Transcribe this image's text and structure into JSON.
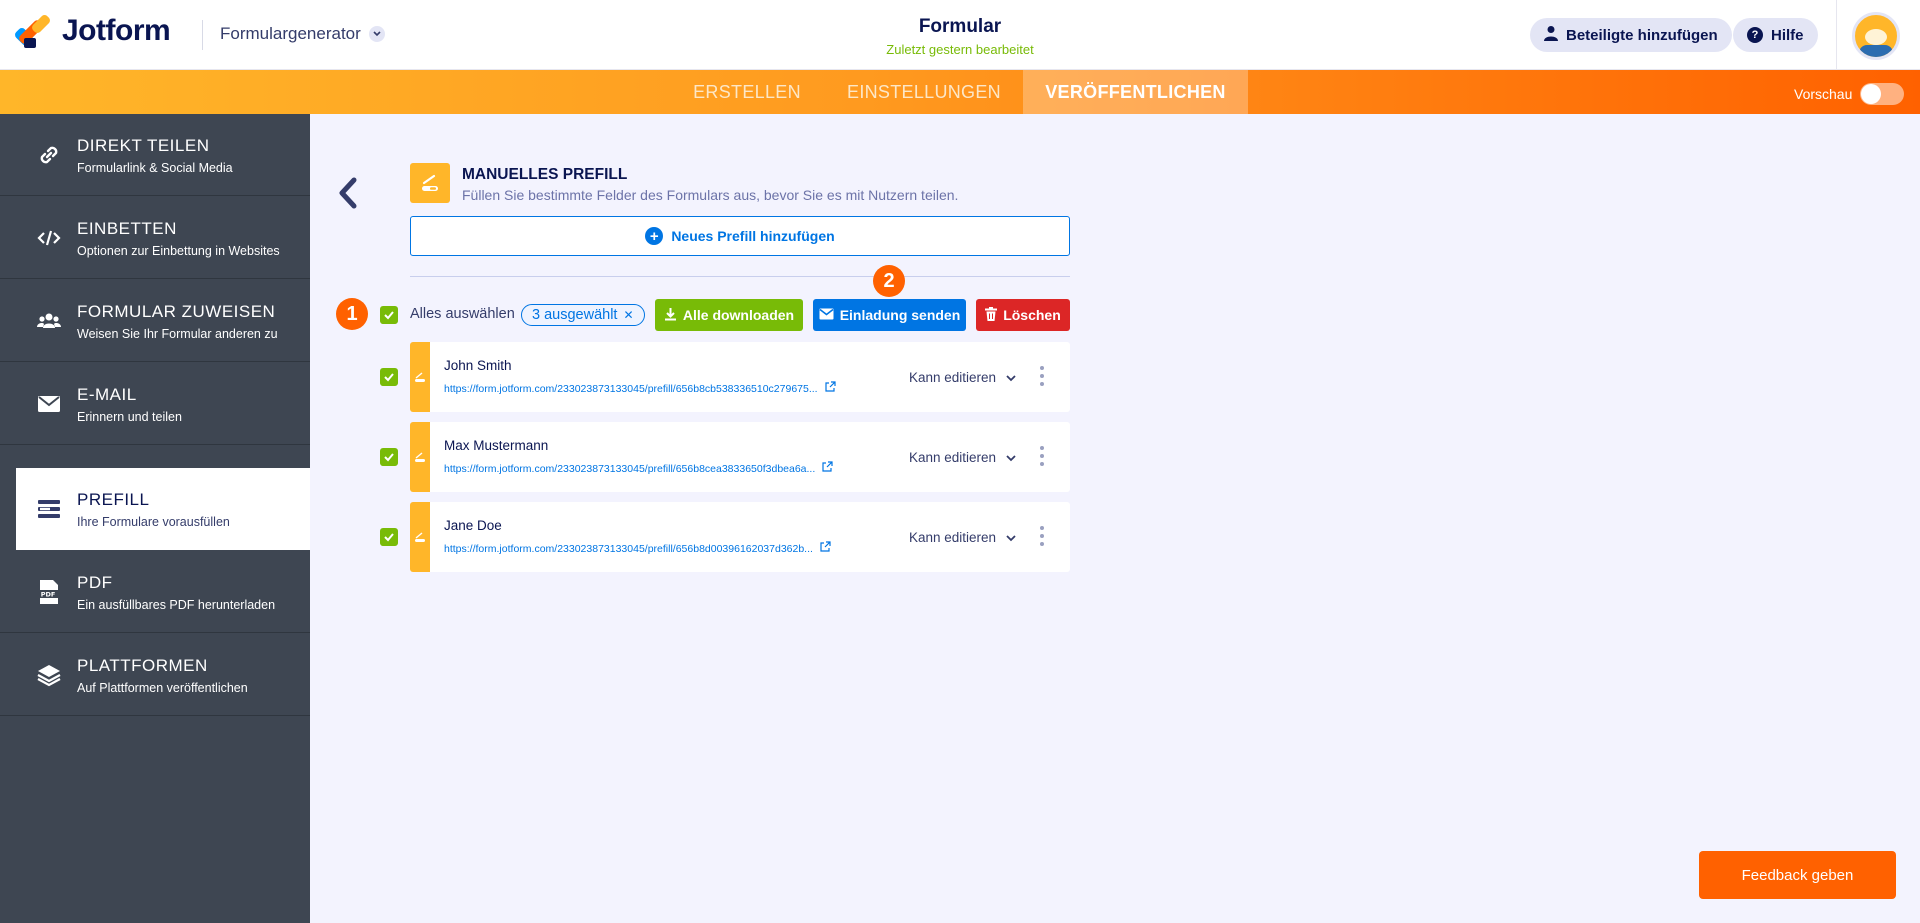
{
  "app": {
    "logo_text": "Jotform",
    "product_label": "Formulargenerator",
    "form_title": "Formular",
    "form_status": "Zuletzt gestern bearbeitet",
    "add_participants_label": "Beteiligte hinzufügen",
    "help_label": "Hilfe"
  },
  "nav": {
    "tabs": [
      {
        "label": "ERSTELLEN"
      },
      {
        "label": "EINSTELLUNGEN"
      },
      {
        "label": "VERÖFFENTLICHEN"
      }
    ],
    "active_tab": "VERÖFFENTLICHEN",
    "preview_label": "Vorschau",
    "preview_on": false
  },
  "sidebar": {
    "items": [
      {
        "title": "DIREKT TEILEN",
        "subtitle": "Formularlink & Social Media",
        "icon": "link-icon"
      },
      {
        "title": "EINBETTEN",
        "subtitle": "Optionen zur Einbettung in Websites",
        "icon": "code-icon"
      },
      {
        "title": "FORMULAR ZUWEISEN",
        "subtitle": "Weisen Sie Ihr Formular anderen zu",
        "icon": "users-icon"
      },
      {
        "title": "E-MAIL",
        "subtitle": "Erinnern und teilen",
        "icon": "envelope-icon"
      },
      {
        "title": "PREFILL",
        "subtitle": "Ihre Formulare vorausfüllen",
        "icon": "prefill-icon"
      },
      {
        "title": "PDF",
        "subtitle": "Ein ausfüllbares PDF herunterladen",
        "icon": "pdf-icon"
      },
      {
        "title": "PLATTFORMEN",
        "subtitle": "Auf Plattformen veröffentlichen",
        "icon": "layers-icon"
      }
    ],
    "active": "PREFILL",
    "pdf_icon_text": "PDF"
  },
  "main": {
    "section_title": "MANUELLES PREFILL",
    "section_subtitle": "Füllen Sie bestimmte Felder des Formulars aus, bevor Sie es mit Nutzern teilen.",
    "new_prefill_label": "Neues Prefill hinzufügen",
    "select_all_label": "Alles auswählen",
    "selected_count_label": "3 ausgewählt",
    "download_all_label": "Alle downloaden",
    "send_invite_label": "Einladung senden",
    "delete_label": "Löschen",
    "step_badges": [
      "1",
      "2"
    ],
    "rows": [
      {
        "name": "John Smith",
        "link": "https://form.jotform.com/233023873133045/prefill/656b8cb538336510c279675...",
        "permission": "Kann editieren",
        "checked": true
      },
      {
        "name": "Max Mustermann",
        "link": "https://form.jotform.com/233023873133045/prefill/656b8cea3833650f3dbea6a...",
        "permission": "Kann editieren",
        "checked": true
      },
      {
        "name": "Jane Doe",
        "link": "https://form.jotform.com/233023873133045/prefill/656b8d00396162037d362b...",
        "permission": "Kann editieren",
        "checked": true
      }
    ]
  },
  "feedback_label": "Feedback geben",
  "colors": {
    "brand_orange": "#ff6100",
    "brand_yellow": "#ffb629",
    "primary_blue": "#0075e3",
    "success_green": "#78bb07",
    "danger_red": "#dc2626",
    "sidebar_bg": "#3e4652"
  }
}
